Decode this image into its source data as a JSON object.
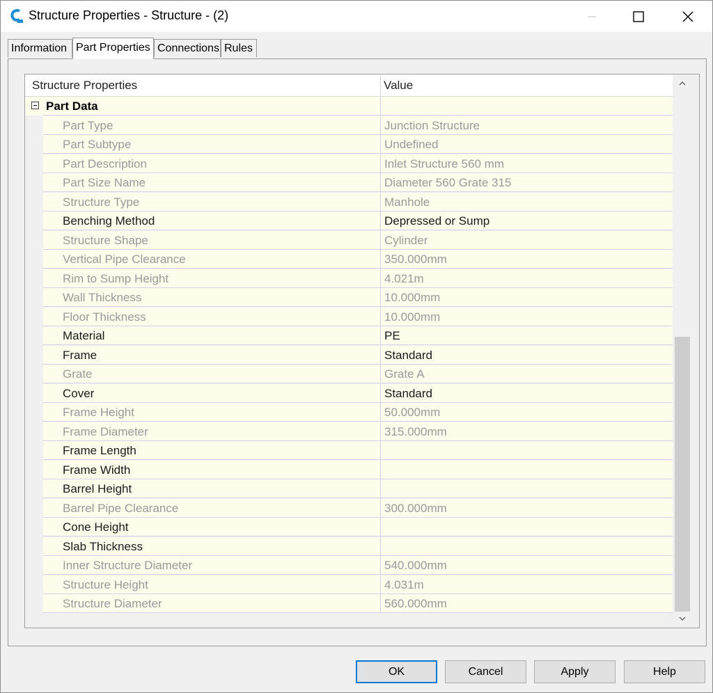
{
  "window": {
    "title": "Structure Properties - Structure - (2)"
  },
  "tabs": [
    {
      "label": "Information"
    },
    {
      "label": "Part Properties"
    },
    {
      "label": "Connections"
    },
    {
      "label": "Rules"
    }
  ],
  "grid": {
    "col_property": "Structure Properties",
    "col_value": "Value",
    "category": "Part Data",
    "rows": [
      {
        "name": "Part Type",
        "value": "Junction Structure",
        "editable": false
      },
      {
        "name": "Part Subtype",
        "value": "Undefined",
        "editable": false
      },
      {
        "name": "Part Description",
        "value": "Inlet Structure 560 mm",
        "editable": false
      },
      {
        "name": "Part Size Name",
        "value": "Diameter 560 Grate 315",
        "editable": false
      },
      {
        "name": "Structure Type",
        "value": "Manhole",
        "editable": false
      },
      {
        "name": "Benching Method",
        "value": "Depressed or Sump",
        "editable": true
      },
      {
        "name": "Structure Shape",
        "value": "Cylinder",
        "editable": false
      },
      {
        "name": "Vertical Pipe Clearance",
        "value": "350.000mm",
        "editable": false
      },
      {
        "name": "Rim to Sump Height",
        "value": "4.021m",
        "editable": false
      },
      {
        "name": "Wall Thickness",
        "value": "10.000mm",
        "editable": false
      },
      {
        "name": "Floor Thickness",
        "value": "10.000mm",
        "editable": false
      },
      {
        "name": "Material",
        "value": "PE",
        "editable": true
      },
      {
        "name": "Frame",
        "value": "Standard",
        "editable": true
      },
      {
        "name": "Grate",
        "value": "Grate A",
        "editable": false
      },
      {
        "name": "Cover",
        "value": "Standard",
        "editable": true
      },
      {
        "name": "Frame Height",
        "value": "50.000mm",
        "editable": false
      },
      {
        "name": "Frame Diameter",
        "value": "315.000mm",
        "editable": false
      },
      {
        "name": "Frame Length",
        "value": "",
        "editable": true
      },
      {
        "name": "Frame Width",
        "value": "",
        "editable": true
      },
      {
        "name": "Barrel Height",
        "value": "",
        "editable": true
      },
      {
        "name": "Barrel Pipe Clearance",
        "value": "300.000mm",
        "editable": false
      },
      {
        "name": "Cone Height",
        "value": "",
        "editable": true
      },
      {
        "name": "Slab Thickness",
        "value": "",
        "editable": true
      },
      {
        "name": "Inner Structure Diameter",
        "value": "540.000mm",
        "editable": false
      },
      {
        "name": "Structure Height",
        "value": "4.031m",
        "editable": false
      },
      {
        "name": "Structure Diameter",
        "value": "560.000mm",
        "editable": false
      }
    ]
  },
  "buttons": {
    "ok": "OK",
    "cancel": "Cancel",
    "apply": "Apply",
    "help": "Help"
  },
  "colors": {
    "row_background": "#fefcea",
    "readonly_text": "#9a9a9a",
    "accent": "#0078d7"
  }
}
